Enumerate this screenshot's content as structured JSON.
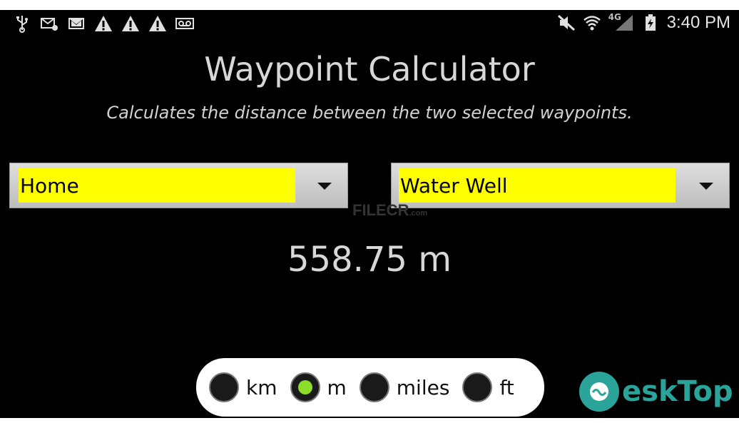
{
  "status_bar": {
    "left_icons": [
      "usb-icon",
      "mail-sync-icon",
      "gmail-icon",
      "warning-icon",
      "warning-icon",
      "warning-icon",
      "voicemail-icon"
    ],
    "right_icons": [
      "mute-icon",
      "wifi-icon",
      "signal-icon",
      "battery-charging-icon"
    ],
    "network_label": "4G",
    "time": "3:40 PM"
  },
  "app": {
    "title": "Waypoint Calculator",
    "subtitle": "Calculates the distance between the two selected waypoints.",
    "waypoint_from": "Home",
    "waypoint_to": "Water Well",
    "distance": "558.75 m"
  },
  "units": {
    "options": [
      "km",
      "m",
      "miles",
      "ft"
    ],
    "selected": "m"
  },
  "watermark": {
    "text": "FILECR",
    "sub": ".com"
  },
  "brand": {
    "text": "eskTop"
  },
  "colors": {
    "spinner_field": "#ffff00",
    "radio_selected": "#8edc2a",
    "brand": "#2aa39a"
  }
}
